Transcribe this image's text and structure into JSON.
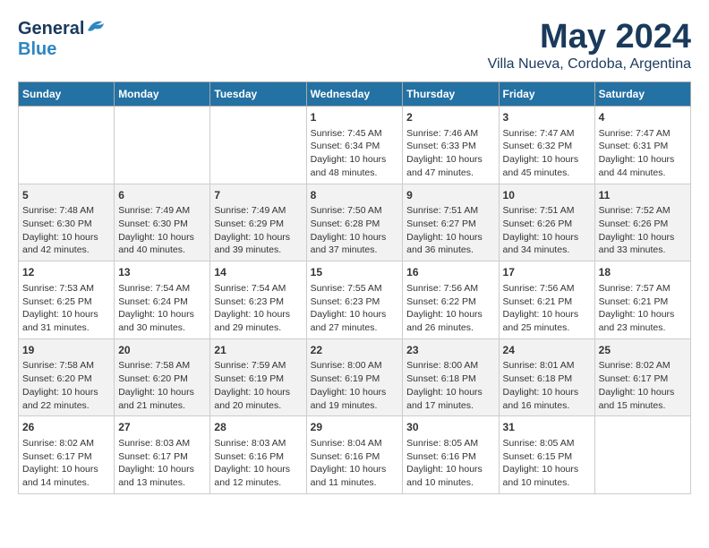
{
  "header": {
    "logo_general": "General",
    "logo_blue": "Blue",
    "month_title": "May 2024",
    "location": "Villa Nueva, Cordoba, Argentina"
  },
  "weekdays": [
    "Sunday",
    "Monday",
    "Tuesday",
    "Wednesday",
    "Thursday",
    "Friday",
    "Saturday"
  ],
  "weeks": [
    [
      {
        "day": "",
        "sunrise": "",
        "sunset": "",
        "daylight": ""
      },
      {
        "day": "",
        "sunrise": "",
        "sunset": "",
        "daylight": ""
      },
      {
        "day": "",
        "sunrise": "",
        "sunset": "",
        "daylight": ""
      },
      {
        "day": "1",
        "sunrise": "Sunrise: 7:45 AM",
        "sunset": "Sunset: 6:34 PM",
        "daylight": "Daylight: 10 hours and 48 minutes."
      },
      {
        "day": "2",
        "sunrise": "Sunrise: 7:46 AM",
        "sunset": "Sunset: 6:33 PM",
        "daylight": "Daylight: 10 hours and 47 minutes."
      },
      {
        "day": "3",
        "sunrise": "Sunrise: 7:47 AM",
        "sunset": "Sunset: 6:32 PM",
        "daylight": "Daylight: 10 hours and 45 minutes."
      },
      {
        "day": "4",
        "sunrise": "Sunrise: 7:47 AM",
        "sunset": "Sunset: 6:31 PM",
        "daylight": "Daylight: 10 hours and 44 minutes."
      }
    ],
    [
      {
        "day": "5",
        "sunrise": "Sunrise: 7:48 AM",
        "sunset": "Sunset: 6:30 PM",
        "daylight": "Daylight: 10 hours and 42 minutes."
      },
      {
        "day": "6",
        "sunrise": "Sunrise: 7:49 AM",
        "sunset": "Sunset: 6:30 PM",
        "daylight": "Daylight: 10 hours and 40 minutes."
      },
      {
        "day": "7",
        "sunrise": "Sunrise: 7:49 AM",
        "sunset": "Sunset: 6:29 PM",
        "daylight": "Daylight: 10 hours and 39 minutes."
      },
      {
        "day": "8",
        "sunrise": "Sunrise: 7:50 AM",
        "sunset": "Sunset: 6:28 PM",
        "daylight": "Daylight: 10 hours and 37 minutes."
      },
      {
        "day": "9",
        "sunrise": "Sunrise: 7:51 AM",
        "sunset": "Sunset: 6:27 PM",
        "daylight": "Daylight: 10 hours and 36 minutes."
      },
      {
        "day": "10",
        "sunrise": "Sunrise: 7:51 AM",
        "sunset": "Sunset: 6:26 PM",
        "daylight": "Daylight: 10 hours and 34 minutes."
      },
      {
        "day": "11",
        "sunrise": "Sunrise: 7:52 AM",
        "sunset": "Sunset: 6:26 PM",
        "daylight": "Daylight: 10 hours and 33 minutes."
      }
    ],
    [
      {
        "day": "12",
        "sunrise": "Sunrise: 7:53 AM",
        "sunset": "Sunset: 6:25 PM",
        "daylight": "Daylight: 10 hours and 31 minutes."
      },
      {
        "day": "13",
        "sunrise": "Sunrise: 7:54 AM",
        "sunset": "Sunset: 6:24 PM",
        "daylight": "Daylight: 10 hours and 30 minutes."
      },
      {
        "day": "14",
        "sunrise": "Sunrise: 7:54 AM",
        "sunset": "Sunset: 6:23 PM",
        "daylight": "Daylight: 10 hours and 29 minutes."
      },
      {
        "day": "15",
        "sunrise": "Sunrise: 7:55 AM",
        "sunset": "Sunset: 6:23 PM",
        "daylight": "Daylight: 10 hours and 27 minutes."
      },
      {
        "day": "16",
        "sunrise": "Sunrise: 7:56 AM",
        "sunset": "Sunset: 6:22 PM",
        "daylight": "Daylight: 10 hours and 26 minutes."
      },
      {
        "day": "17",
        "sunrise": "Sunrise: 7:56 AM",
        "sunset": "Sunset: 6:21 PM",
        "daylight": "Daylight: 10 hours and 25 minutes."
      },
      {
        "day": "18",
        "sunrise": "Sunrise: 7:57 AM",
        "sunset": "Sunset: 6:21 PM",
        "daylight": "Daylight: 10 hours and 23 minutes."
      }
    ],
    [
      {
        "day": "19",
        "sunrise": "Sunrise: 7:58 AM",
        "sunset": "Sunset: 6:20 PM",
        "daylight": "Daylight: 10 hours and 22 minutes."
      },
      {
        "day": "20",
        "sunrise": "Sunrise: 7:58 AM",
        "sunset": "Sunset: 6:20 PM",
        "daylight": "Daylight: 10 hours and 21 minutes."
      },
      {
        "day": "21",
        "sunrise": "Sunrise: 7:59 AM",
        "sunset": "Sunset: 6:19 PM",
        "daylight": "Daylight: 10 hours and 20 minutes."
      },
      {
        "day": "22",
        "sunrise": "Sunrise: 8:00 AM",
        "sunset": "Sunset: 6:19 PM",
        "daylight": "Daylight: 10 hours and 19 minutes."
      },
      {
        "day": "23",
        "sunrise": "Sunrise: 8:00 AM",
        "sunset": "Sunset: 6:18 PM",
        "daylight": "Daylight: 10 hours and 17 minutes."
      },
      {
        "day": "24",
        "sunrise": "Sunrise: 8:01 AM",
        "sunset": "Sunset: 6:18 PM",
        "daylight": "Daylight: 10 hours and 16 minutes."
      },
      {
        "day": "25",
        "sunrise": "Sunrise: 8:02 AM",
        "sunset": "Sunset: 6:17 PM",
        "daylight": "Daylight: 10 hours and 15 minutes."
      }
    ],
    [
      {
        "day": "26",
        "sunrise": "Sunrise: 8:02 AM",
        "sunset": "Sunset: 6:17 PM",
        "daylight": "Daylight: 10 hours and 14 minutes."
      },
      {
        "day": "27",
        "sunrise": "Sunrise: 8:03 AM",
        "sunset": "Sunset: 6:17 PM",
        "daylight": "Daylight: 10 hours and 13 minutes."
      },
      {
        "day": "28",
        "sunrise": "Sunrise: 8:03 AM",
        "sunset": "Sunset: 6:16 PM",
        "daylight": "Daylight: 10 hours and 12 minutes."
      },
      {
        "day": "29",
        "sunrise": "Sunrise: 8:04 AM",
        "sunset": "Sunset: 6:16 PM",
        "daylight": "Daylight: 10 hours and 11 minutes."
      },
      {
        "day": "30",
        "sunrise": "Sunrise: 8:05 AM",
        "sunset": "Sunset: 6:16 PM",
        "daylight": "Daylight: 10 hours and 10 minutes."
      },
      {
        "day": "31",
        "sunrise": "Sunrise: 8:05 AM",
        "sunset": "Sunset: 6:15 PM",
        "daylight": "Daylight: 10 hours and 10 minutes."
      },
      {
        "day": "",
        "sunrise": "",
        "sunset": "",
        "daylight": ""
      }
    ]
  ]
}
